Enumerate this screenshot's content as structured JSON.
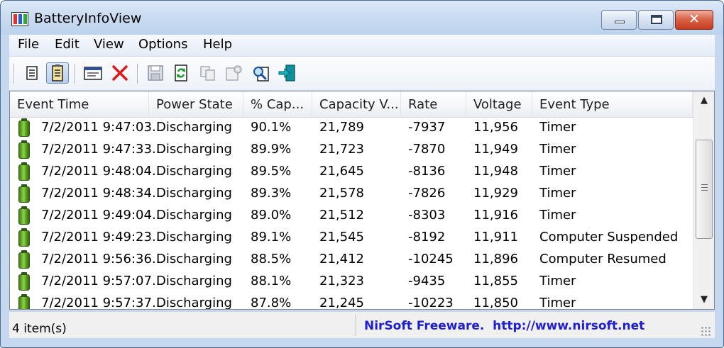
{
  "window": {
    "title": "BatteryInfoView",
    "close_glyph": "✕"
  },
  "menu": [
    "File",
    "Edit",
    "View",
    "Options",
    "Help"
  ],
  "toolbar": {
    "buttons": [
      "properties-icon",
      "battery-log-icon",
      "html-report-icon",
      "delete-icon",
      "save-icon",
      "refresh-icon",
      "copy-icon",
      "options-icon",
      "find-icon",
      "exit-icon"
    ]
  },
  "table": {
    "columns": [
      "Event Time",
      "Power State",
      "% Cap...",
      "Capacity V...",
      "Rate",
      "Voltage",
      "Event Type"
    ],
    "rows": [
      [
        "7/2/2011 9:47:03...",
        "Discharging",
        "90.1%",
        "21,789",
        "-7937",
        "11,956",
        "Timer"
      ],
      [
        "7/2/2011 9:47:33...",
        "Discharging",
        "89.9%",
        "21,723",
        "-7870",
        "11,949",
        "Timer"
      ],
      [
        "7/2/2011 9:48:04...",
        "Discharging",
        "89.5%",
        "21,645",
        "-8136",
        "11,948",
        "Timer"
      ],
      [
        "7/2/2011 9:48:34...",
        "Discharging",
        "89.3%",
        "21,578",
        "-7826",
        "11,929",
        "Timer"
      ],
      [
        "7/2/2011 9:49:04...",
        "Discharging",
        "89.0%",
        "21,512",
        "-8303",
        "11,916",
        "Timer"
      ],
      [
        "7/2/2011 9:49:23...",
        "Discharging",
        "89.1%",
        "21,545",
        "-8192",
        "11,911",
        "Computer Suspended"
      ],
      [
        "7/2/2011 9:56:36...",
        "Discharging",
        "88.5%",
        "21,412",
        "-10245",
        "11,896",
        "Computer Resumed"
      ],
      [
        "7/2/2011 9:57:07...",
        "Discharging",
        "88.1%",
        "21,323",
        "-9435",
        "11,855",
        "Timer"
      ],
      [
        "7/2/2011 9:57:37...",
        "Discharging",
        "87.8%",
        "21,245",
        "-10223",
        "11,850",
        "Timer"
      ]
    ]
  },
  "status": {
    "items": "4 item(s)",
    "link": "NirSoft Freeware.  http://www.nirsoft.net"
  },
  "colors": {
    "link": "#1f1fd0",
    "battery": "#5aa01c",
    "close_button": "#c63b1e"
  }
}
